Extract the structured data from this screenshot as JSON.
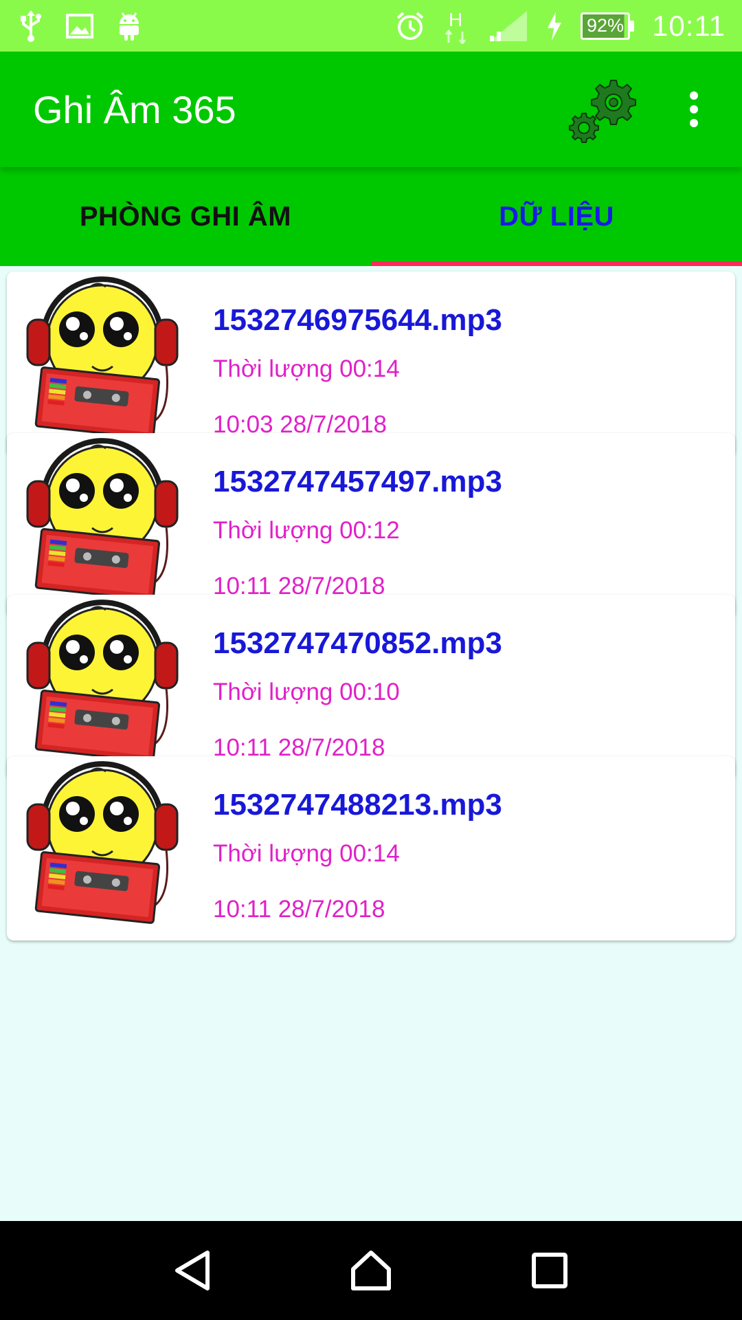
{
  "status_bar": {
    "battery": "92%",
    "time": "10:11",
    "network": "H",
    "icons": [
      "usb-icon",
      "image-icon",
      "android-icon",
      "alarm-icon",
      "network-h-icon",
      "signal-icon",
      "charging-icon",
      "battery-icon"
    ]
  },
  "app_bar": {
    "title": "Ghi Âm 365",
    "settings_icon": "gear-icon",
    "menu_icon": "more-vert-icon"
  },
  "tabs": [
    {
      "label": "PHÒNG GHI ÂM",
      "selected": false
    },
    {
      "label": "DỮ LIỆU",
      "selected": true
    }
  ],
  "accent_colors": {
    "status_bar": "#8afa4a",
    "app_bar": "#00c800",
    "tab_indicator": "#ff2a5a",
    "filename": "#1818d8",
    "meta": "#e020c8",
    "background": "#e8fdf9"
  },
  "recordings": [
    {
      "name": "1532746975644.mp3",
      "duration": "Thời lượng 00:14",
      "date": "10:03 28/7/2018"
    },
    {
      "name": "1532747457497.mp3",
      "duration": "Thời lượng 00:12",
      "date": "10:11 28/7/2018"
    },
    {
      "name": "1532747470852.mp3",
      "duration": "Thời lượng 00:10",
      "date": "10:11 28/7/2018"
    },
    {
      "name": "1532747488213.mp3",
      "duration": "Thời lượng 00:14",
      "date": "10:11 28/7/2018"
    }
  ],
  "nav_bar": {
    "icons": [
      "back-icon",
      "home-icon",
      "recents-icon"
    ]
  }
}
